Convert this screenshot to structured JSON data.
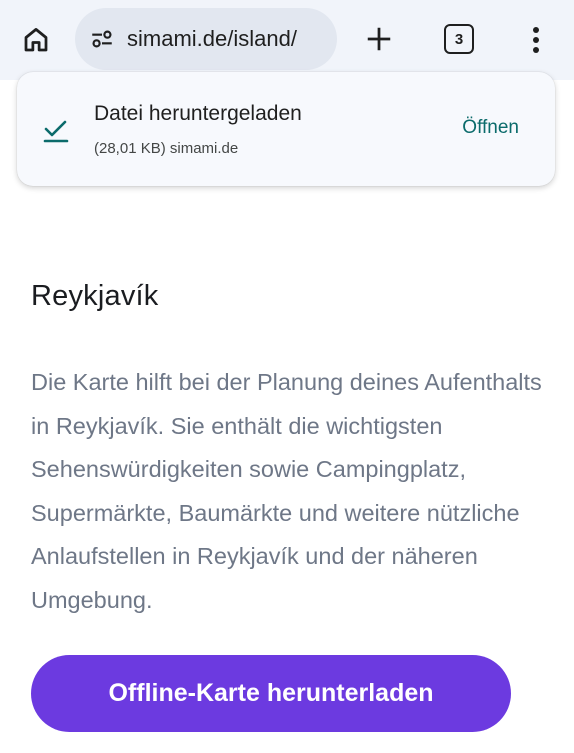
{
  "browser": {
    "url": "simami.de/island/",
    "tab_count": "3"
  },
  "download_toast": {
    "title": "Datei heruntergeladen",
    "subtitle": "(28,01 KB) simami.de",
    "action_label": "Öffnen"
  },
  "page": {
    "heading": "Reykjavík",
    "description": "Die Karte hilft bei der Planung deines Aufenthalts in Reykjavík. Sie enthält die wichtigsten Sehenswürdigkeiten sowie Campingplatz, Supermärkte, Baumärkte und weitere nützliche Anlaufstellen in Reykjavík und der näheren Umgebung.",
    "cta_label": "Offline-Karte herunterladen"
  },
  "colors": {
    "accent": "#6c3ae0",
    "toast_action": "#0b6b6b",
    "text_muted": "#6e7787"
  },
  "icons": {
    "home": "home-icon",
    "site_settings": "tune-icon",
    "new_tab": "plus-icon",
    "menu": "more-vert-icon",
    "download_done": "check-icon"
  }
}
